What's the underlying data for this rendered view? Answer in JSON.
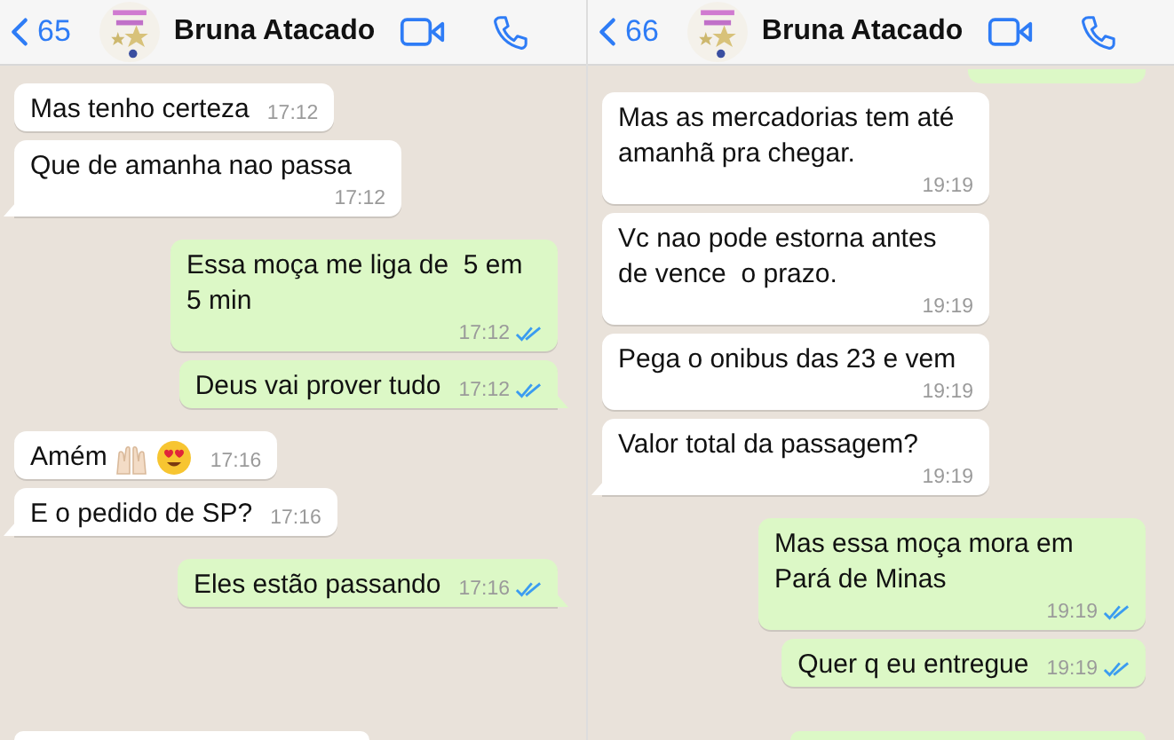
{
  "panels": [
    {
      "header": {
        "back_count": "65",
        "contact_name": "Bruna Atacado"
      },
      "bottom_fragment": {
        "outgoing": false
      },
      "messages": [
        {
          "outgoing": false,
          "text": "Mas tenho certeza",
          "time": "17:12",
          "tail": false
        },
        {
          "outgoing": false,
          "text": "Que de amanha nao passa",
          "time": "17:12",
          "tail": true
        },
        {
          "outgoing": true,
          "text": "Essa moça me liga de  5 em 5 min",
          "time": "17:12",
          "read": true,
          "tail": false
        },
        {
          "outgoing": true,
          "text": "Deus vai prover tudo",
          "time": "17:12",
          "read": true,
          "tail": true
        },
        {
          "outgoing": false,
          "text": "Amém",
          "emoji": true,
          "time": "17:16",
          "tail": false
        },
        {
          "outgoing": false,
          "text": "E o pedido de SP?",
          "time": "17:16",
          "tail": true
        },
        {
          "outgoing": true,
          "text": "Eles estão passando",
          "time": "17:16",
          "read": true,
          "tail": true
        }
      ]
    },
    {
      "header": {
        "back_count": "66",
        "contact_name": "Bruna Atacado"
      },
      "top_fragment": true,
      "bottom_fragment": {
        "outgoing": true
      },
      "messages": [
        {
          "outgoing": false,
          "text": "Mas as mercadorias tem até amanhã pra chegar.",
          "time": "19:19",
          "tail": false
        },
        {
          "outgoing": false,
          "text": "Vc nao pode estorna antes de vence  o prazo.",
          "time": "19:19",
          "tail": false
        },
        {
          "outgoing": false,
          "text": "Pega o onibus das 23 e vem",
          "time": "19:19",
          "tail": false
        },
        {
          "outgoing": false,
          "text": "Valor total da passagem?",
          "time": "19:19",
          "tail": true
        },
        {
          "outgoing": true,
          "text": "Mas essa moça mora em Pará de Minas",
          "time": "19:19",
          "read": true,
          "tail": false
        },
        {
          "outgoing": true,
          "text": "Quer q eu entregue",
          "time": "19:19",
          "read": true,
          "tail": false
        }
      ]
    }
  ]
}
